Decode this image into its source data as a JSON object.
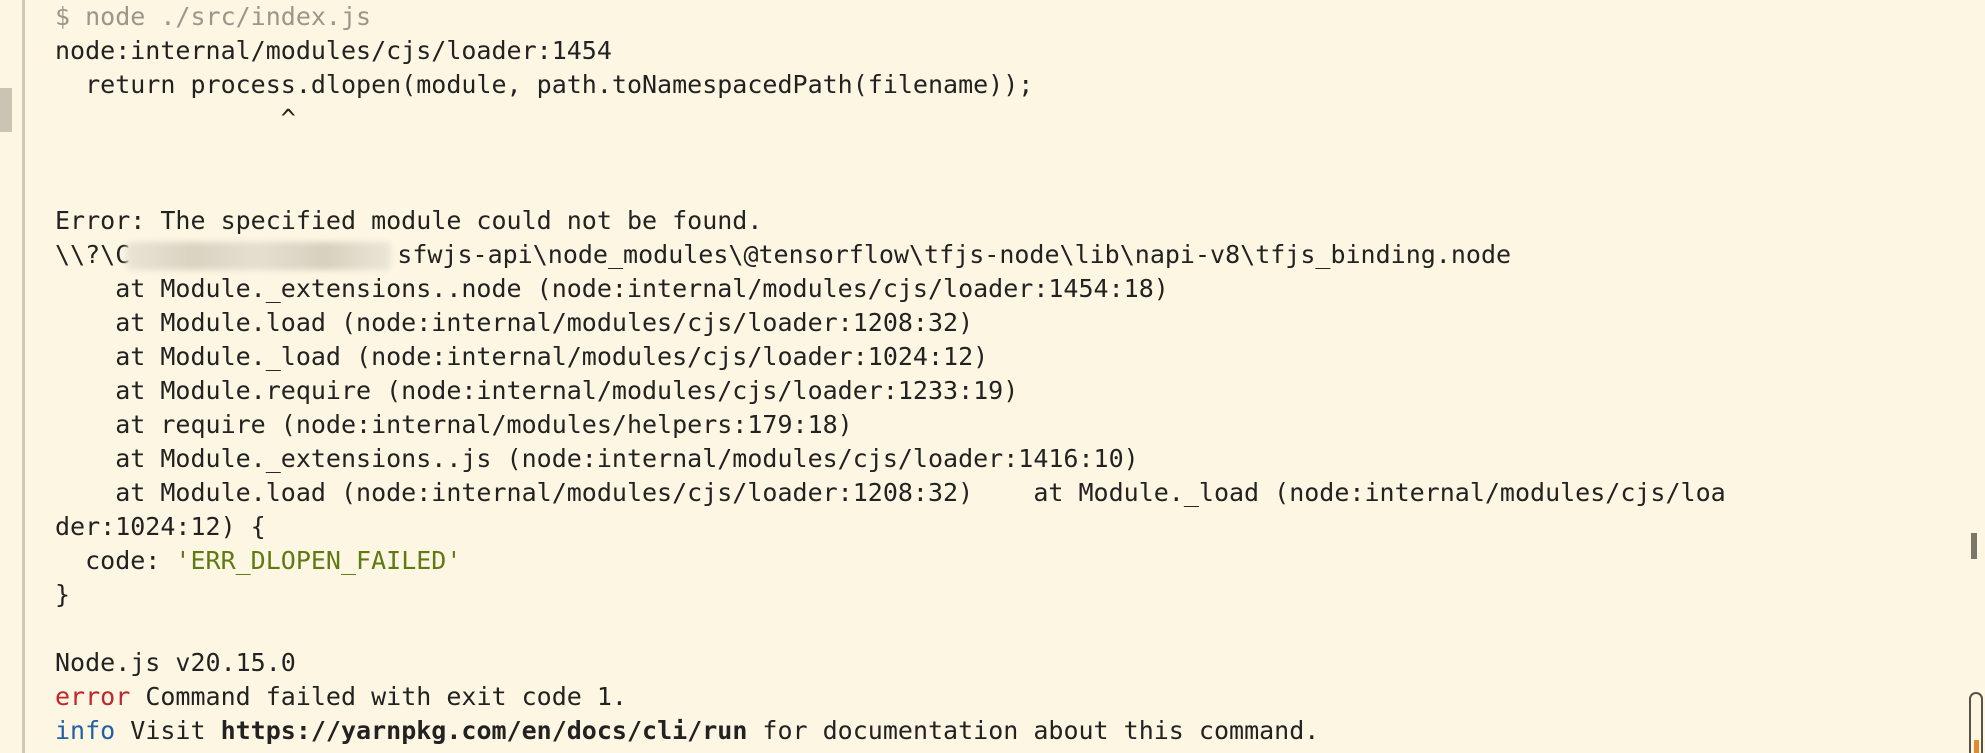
{
  "terminal": {
    "lines": [
      {
        "kind": "dim",
        "text": "$ node ./src/index.js"
      },
      {
        "kind": "plain",
        "text": "node:internal/modules/cjs/loader:1454"
      },
      {
        "kind": "plain",
        "text": "  return process.dlopen(module, path.toNamespacedPath(filename));"
      },
      {
        "kind": "plain",
        "text": "               ^"
      },
      {
        "kind": "blank",
        "text": ""
      },
      {
        "kind": "blank",
        "text": ""
      },
      {
        "kind": "plain",
        "text": "Error: The specified module could not be found."
      },
      {
        "kind": "path",
        "prefix": "\\\\?\\C",
        "suffix": "sfwjs-api\\node_modules\\@tensorflow\\tfjs-node\\lib\\napi-v8\\tfjs_binding.node"
      },
      {
        "kind": "plain",
        "text": "    at Module._extensions..node (node:internal/modules/cjs/loader:1454:18)"
      },
      {
        "kind": "plain",
        "text": "    at Module.load (node:internal/modules/cjs/loader:1208:32)"
      },
      {
        "kind": "plain",
        "text": "    at Module._load (node:internal/modules/cjs/loader:1024:12)"
      },
      {
        "kind": "plain",
        "text": "    at Module.require (node:internal/modules/cjs/loader:1233:19)"
      },
      {
        "kind": "plain",
        "text": "    at require (node:internal/modules/helpers:179:18)"
      },
      {
        "kind": "plain",
        "text": "    at Module._extensions..js (node:internal/modules/cjs/loader:1416:10)"
      },
      {
        "kind": "plain",
        "text": "    at Module.load (node:internal/modules/cjs/loader:1208:32)    at Module._load (node:internal/modules/cjs/loa"
      },
      {
        "kind": "plain",
        "text": "der:1024:12) {"
      },
      {
        "kind": "code",
        "key": "  code: ",
        "value": "'ERR_DLOPEN_FAILED'"
      },
      {
        "kind": "plain",
        "text": "}"
      },
      {
        "kind": "blank",
        "text": ""
      },
      {
        "kind": "plain",
        "text": "Node.js v20.15.0"
      },
      {
        "kind": "error",
        "label": "error",
        "text": " Command failed with exit code 1."
      },
      {
        "kind": "info",
        "label": "info",
        "pre": " Visit ",
        "link": "https://yarnpkg.com/en/docs/cli/run",
        "post": " for documentation about this command."
      }
    ]
  },
  "colors": {
    "background": "#fdf6e3",
    "text": "#222222",
    "prompt": "#9a968b",
    "string": "#5f7a13",
    "error": "#c0262d",
    "info": "#1f61a8"
  }
}
